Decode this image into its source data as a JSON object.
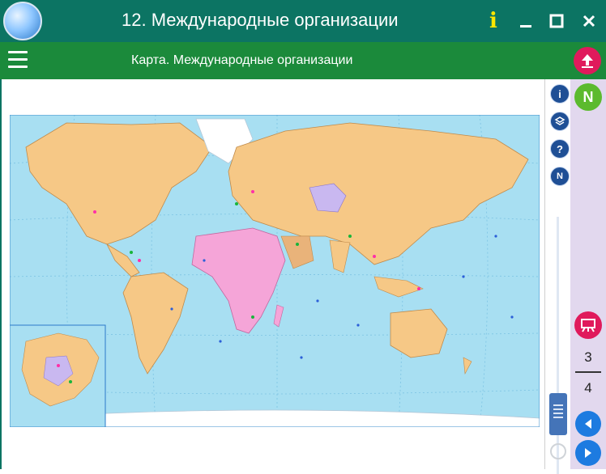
{
  "window": {
    "title": "12. Международные организации",
    "info_label": "i",
    "minimize_label": "—",
    "maximize_label": "☐",
    "close_label": "✕"
  },
  "header": {
    "subtitle": "Карта. Международные организации",
    "up_icon": "upload-arrow-icon"
  },
  "tools": [
    "info-icon",
    "layers-icon",
    "help-icon",
    "n-icon"
  ],
  "side": {
    "n_label": "N",
    "current_page": "3",
    "total_pages": "4"
  }
}
